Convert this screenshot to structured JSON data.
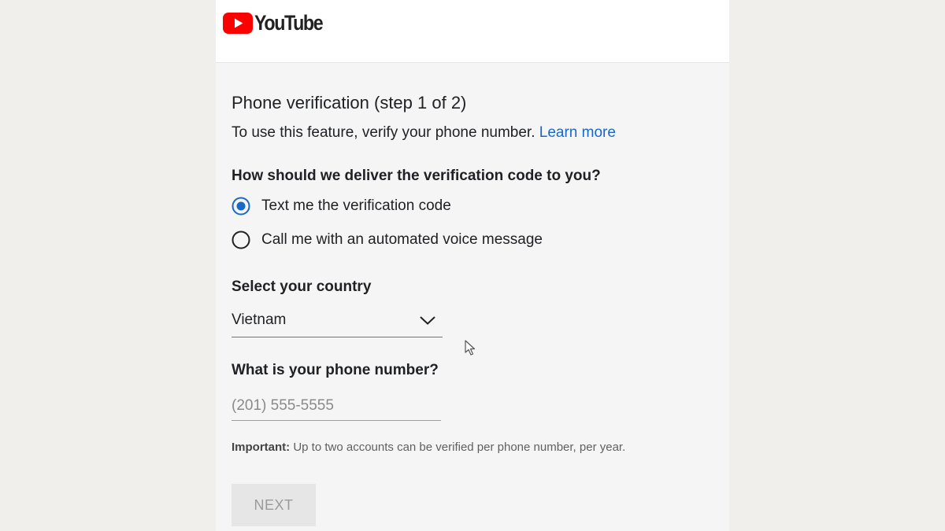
{
  "header": {
    "logo_text": "YouTube",
    "brand_color": "#ff0000"
  },
  "form": {
    "title": "Phone verification (step 1 of 2)",
    "subtitle": "To use this feature, verify your phone number.",
    "learn_more": "Learn more",
    "delivery_question": "How should we deliver the verification code to you?",
    "delivery_options": [
      {
        "label": "Text me the verification code",
        "selected": true
      },
      {
        "label": "Call me with an automated voice message",
        "selected": false
      }
    ],
    "country_label": "Select your country",
    "country_value": "Vietnam",
    "phone_label": "What is your phone number?",
    "phone_placeholder": "(201) 555-5555",
    "phone_value": "",
    "note_label": "Important:",
    "note_text": " Up to two accounts can be verified per phone number, per year.",
    "next_label": "NEXT"
  },
  "colors": {
    "accent": "#1a68c7",
    "radio_selected": "#1a68c7",
    "button_disabled_bg": "#e6e6e6",
    "button_disabled_text": "#9a9a9a"
  }
}
